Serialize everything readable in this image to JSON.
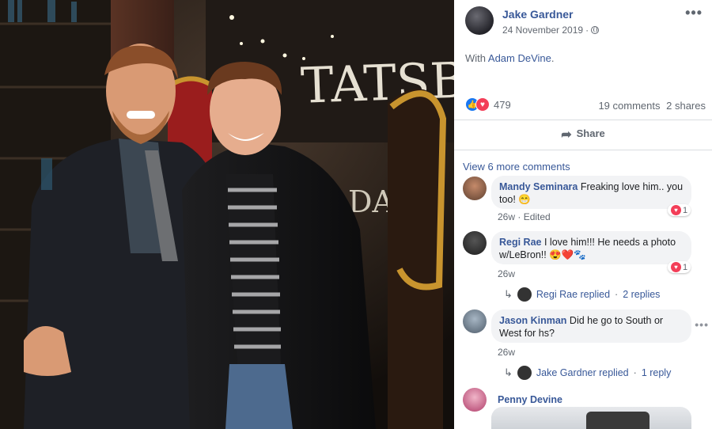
{
  "post": {
    "author": "Jake Gardner",
    "date": "24 November 2019",
    "date_separator": "·",
    "with_prefix": "With",
    "with_name": "Adam DeVine",
    "with_suffix": ".",
    "reaction_count": "479",
    "comments_count": "19 comments",
    "shares_count": "2 shares",
    "share_label": "Share",
    "more_icon": "more-horizontal-icon",
    "privacy_icon": "globe-icon"
  },
  "comments": {
    "view_more": "View 6 more comments",
    "items": [
      {
        "name": "Mandy Seminara",
        "text": "Freaking love him.. you too! 😁",
        "time": "26w",
        "edited": "· Edited",
        "reactions": "1"
      },
      {
        "name": "Regi Rae",
        "text": "I love him!!! He needs a photo w/LeBron!! 😍❤️🐾",
        "time": "26w",
        "reactions": "1",
        "reply_name": "Regi Rae replied",
        "reply_sep": "·",
        "reply_count": "2 replies"
      },
      {
        "name": "Jason Kinman",
        "text": "Did he go to South or West for hs?",
        "time": "26w",
        "reply_name": "Jake Gardner replied",
        "reply_sep": "·",
        "reply_count": "1 reply"
      },
      {
        "name": "Penny Devine"
      }
    ]
  },
  "photo": {
    "sign_text": "TATSBY",
    "sign_text_2": "DAM"
  },
  "colors": {
    "link": "#385898",
    "like": "#1877f2",
    "love": "#f33e58",
    "bubble": "#f2f3f5"
  }
}
